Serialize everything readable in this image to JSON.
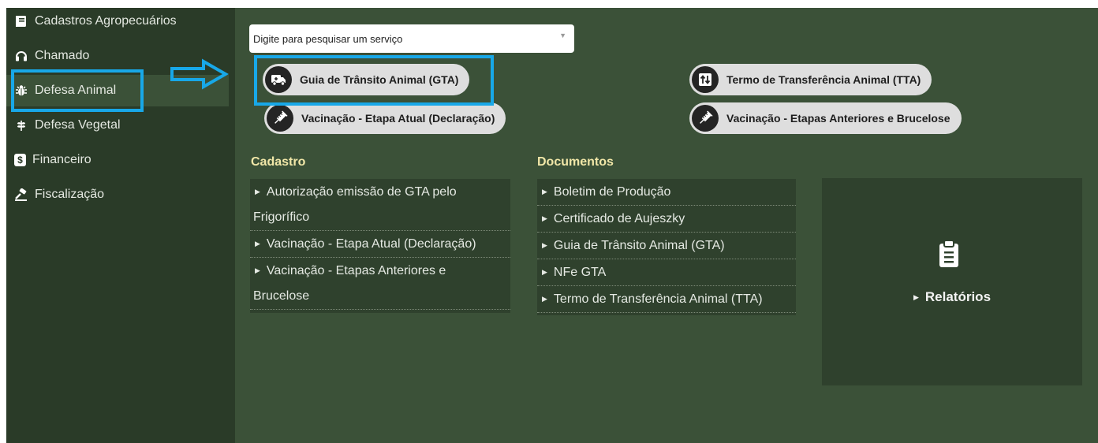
{
  "sidebar": {
    "items": [
      {
        "label": "Cadastros Agropecuários",
        "icon": "book-icon"
      },
      {
        "label": "Chamado",
        "icon": "headset-icon"
      },
      {
        "label": "Defesa Animal",
        "icon": "bug-icon"
      },
      {
        "label": "Defesa Vegetal",
        "icon": "leaf-icon"
      },
      {
        "label": "Financeiro",
        "icon": "dollar-icon"
      },
      {
        "label": "Fiscalização",
        "icon": "gavel-icon"
      }
    ],
    "active": "Defesa Animal"
  },
  "search": {
    "placeholder": "Digite para pesquisar um serviço"
  },
  "shortcuts": [
    {
      "label": "Guia de Trânsito Animal (GTA)",
      "icon": "truck-icon"
    },
    {
      "label": "Vacinação - Etapa Atual (Declaração)",
      "icon": "syringe-icon"
    },
    {
      "label": "Termo de Transferência Animal (TTA)",
      "icon": "transfer-icon"
    },
    {
      "label": "Vacinação - Etapas Anteriores e Brucelose",
      "icon": "syringe-icon"
    }
  ],
  "cadastro": {
    "title": "Cadastro",
    "links": [
      {
        "line1": "Autorização emissão de GTA pelo",
        "line2": "Frigorífico"
      },
      {
        "line1": "Vacinação - Etapa Atual (Declaração)",
        "line2": ""
      },
      {
        "line1": "Vacinação - Etapas Anteriores e",
        "line2": "Brucelose"
      }
    ]
  },
  "documentos": {
    "title": "Documentos",
    "links": [
      "Boletim de Produção",
      "Certificado de Aujeszky",
      "Guia de Trânsito Animal (GTA)",
      "NFe GTA",
      "Termo de Transferência Animal (TTA)"
    ]
  },
  "reports": {
    "label": "Relatórios",
    "icon": "clipboard-icon"
  },
  "colors": {
    "highlight": "#18a8e8",
    "sidebar_bg": "#2a3b28",
    "content_bg": "#3b5138",
    "section_title": "#f1e7a8"
  }
}
